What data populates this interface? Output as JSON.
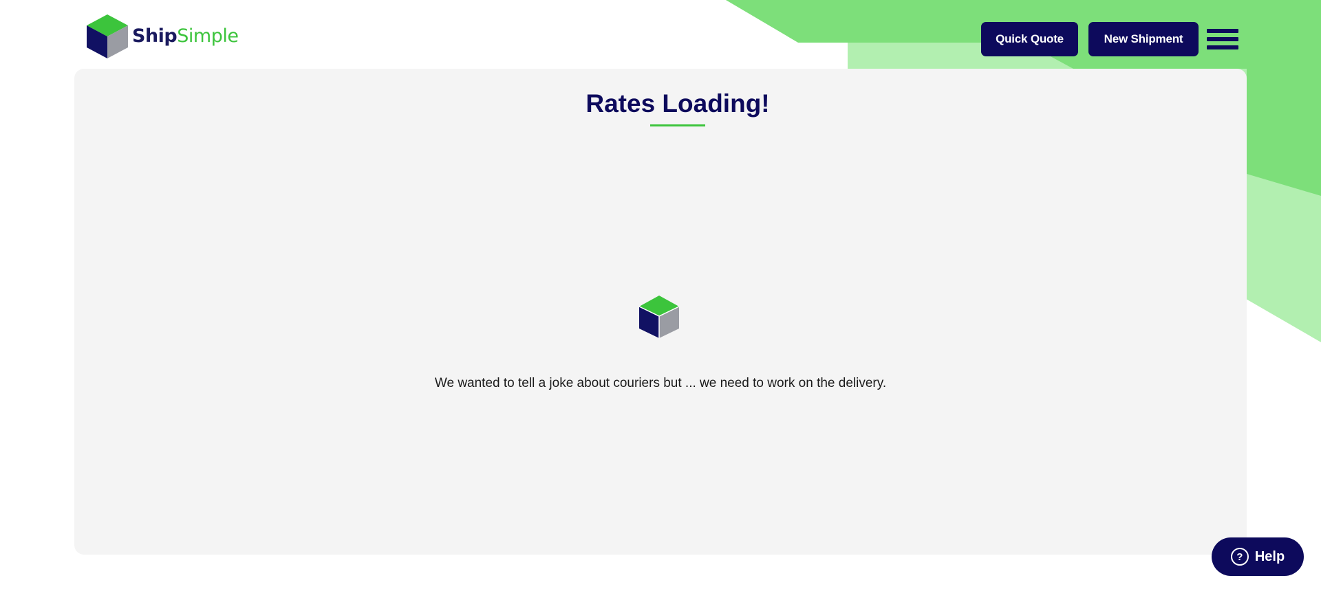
{
  "brand": {
    "name_part1": "Ship",
    "name_part2": "Simple",
    "colors": {
      "navy": "#0d0a5c",
      "green": "#3cc43c",
      "light_green": "#7ddf7a",
      "pale_green": "#b2efb0",
      "card_bg": "#f4f4f4"
    }
  },
  "header": {
    "logo_icon": "cube-logo-icon",
    "quick_quote_label": "Quick Quote",
    "new_shipment_label": "New Shipment",
    "menu_icon": "hamburger-menu-icon"
  },
  "main": {
    "title": "Rates Loading!",
    "loader_icon": "cube-loader-icon",
    "joke": "We wanted to tell a joke about couriers but ... we need to work on the delivery."
  },
  "help": {
    "icon": "question-circle-icon",
    "label": "Help",
    "icon_glyph": "?"
  }
}
